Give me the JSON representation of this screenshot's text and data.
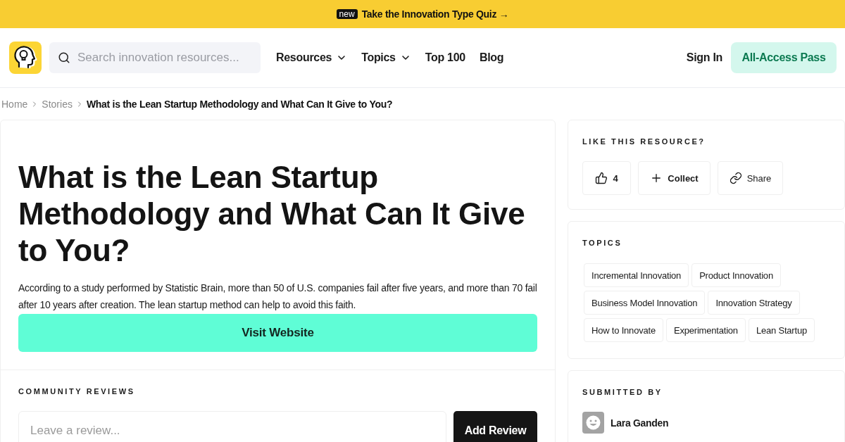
{
  "banner": {
    "badge": "new",
    "text": "Take the Innovation Type Quiz →"
  },
  "header": {
    "search": {
      "placeholder": "Search innovation resources..."
    },
    "nav": [
      {
        "label": "Resources",
        "kind": "dropdown"
      },
      {
        "label": "Topics",
        "kind": "dropdown"
      },
      {
        "label": "Top 100",
        "kind": "link"
      },
      {
        "label": "Blog",
        "kind": "link"
      }
    ],
    "sign_in": "Sign In",
    "cta": "All-Access Pass"
  },
  "breadcrumb": [
    {
      "label": "Home",
      "current": false
    },
    {
      "label": "Stories",
      "current": false
    },
    {
      "label": "What is the Lean Startup Methodology and What Can It Give to You?",
      "current": true
    }
  ],
  "article": {
    "title": "What is the Lean Startup Methodology and What Can It Give to You?",
    "summary": "According to a study performed by Statistic Brain, more than 50 of U.S. companies fail after five years, and more than 70 fail after 10 years after creation. The lean startup method can help to avoid this faith.",
    "visit_button": "Visit Website"
  },
  "reviews": {
    "heading": "COMMUNITY REVIEWS",
    "input": {
      "placeholder": "Leave a review..."
    },
    "button": "Add Review"
  },
  "like_card": {
    "heading": "LIKE THIS RESOURCE?",
    "actions": [
      {
        "kind": "like",
        "label": "4"
      },
      {
        "kind": "collect",
        "label": "Collect"
      },
      {
        "kind": "share",
        "label": "Share"
      }
    ]
  },
  "topics": {
    "heading": "TOPICS",
    "tags": [
      "Incremental Innovation",
      "Product Innovation",
      "Business Model Innovation",
      "Innovation Strategy",
      "How to Innovate",
      "Experimentation",
      "Lean Startup"
    ]
  },
  "submitted_by": {
    "heading": "SUBMITTED BY",
    "name": "Lara Ganden"
  }
}
